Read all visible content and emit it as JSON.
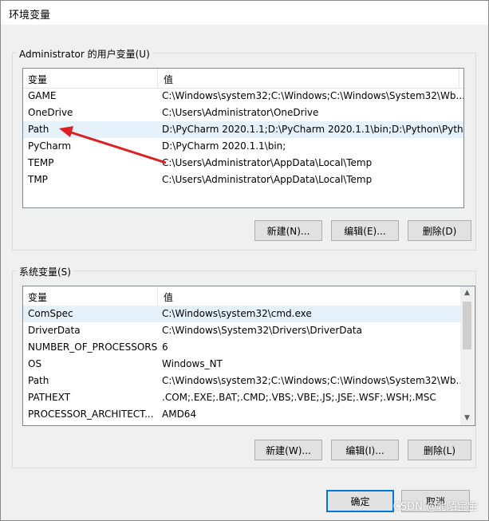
{
  "window": {
    "title": "环境变量"
  },
  "user_vars": {
    "group_label": "Administrator 的用户变量(U)",
    "col_var": "变量",
    "col_val": "值",
    "rows": [
      {
        "name": "GAME",
        "value": "C:\\Windows\\system32;C:\\Windows;C:\\Windows\\System32\\Wb..."
      },
      {
        "name": "OneDrive",
        "value": "C:\\Users\\Administrator\\OneDrive"
      },
      {
        "name": "Path",
        "value": "D:\\PyCharm 2020.1.1;D:\\PyCharm 2020.1.1\\bin;D:\\Python\\Pyth..."
      },
      {
        "name": "PyCharm",
        "value": "D:\\PyCharm 2020.1.1\\bin;"
      },
      {
        "name": "TEMP",
        "value": "C:\\Users\\Administrator\\AppData\\Local\\Temp"
      },
      {
        "name": "TMP",
        "value": "C:\\Users\\Administrator\\AppData\\Local\\Temp"
      }
    ],
    "new_label": "新建(N)...",
    "edit_label": "编辑(E)...",
    "delete_label": "删除(D)"
  },
  "sys_vars": {
    "group_label": "系统变量(S)",
    "col_var": "变量",
    "col_val": "值",
    "rows": [
      {
        "name": "ComSpec",
        "value": "C:\\Windows\\system32\\cmd.exe"
      },
      {
        "name": "DriverData",
        "value": "C:\\Windows\\System32\\Drivers\\DriverData"
      },
      {
        "name": "NUMBER_OF_PROCESSORS",
        "value": "6"
      },
      {
        "name": "OS",
        "value": "Windows_NT"
      },
      {
        "name": "Path",
        "value": "C:\\Windows\\system32;C:\\Windows;C:\\Windows\\System32\\Wb..."
      },
      {
        "name": "PATHEXT",
        "value": ".COM;.EXE;.BAT;.CMD;.VBS;.VBE;.JS;.JSE;.WSF;.WSH;.MSC"
      },
      {
        "name": "PROCESSOR_ARCHITECT...",
        "value": "AMD64"
      }
    ],
    "new_label": "新建(W)...",
    "edit_label": "编辑(I)...",
    "delete_label": "删除(L)"
  },
  "footer": {
    "ok_label": "确定",
    "cancel_label": "取消"
  },
  "watermark": "CSDN @北陌宝宝",
  "colors": {
    "annotation_arrow": "#e02020",
    "selection": "#e5f1fb",
    "focus_border": "#0078d7"
  }
}
